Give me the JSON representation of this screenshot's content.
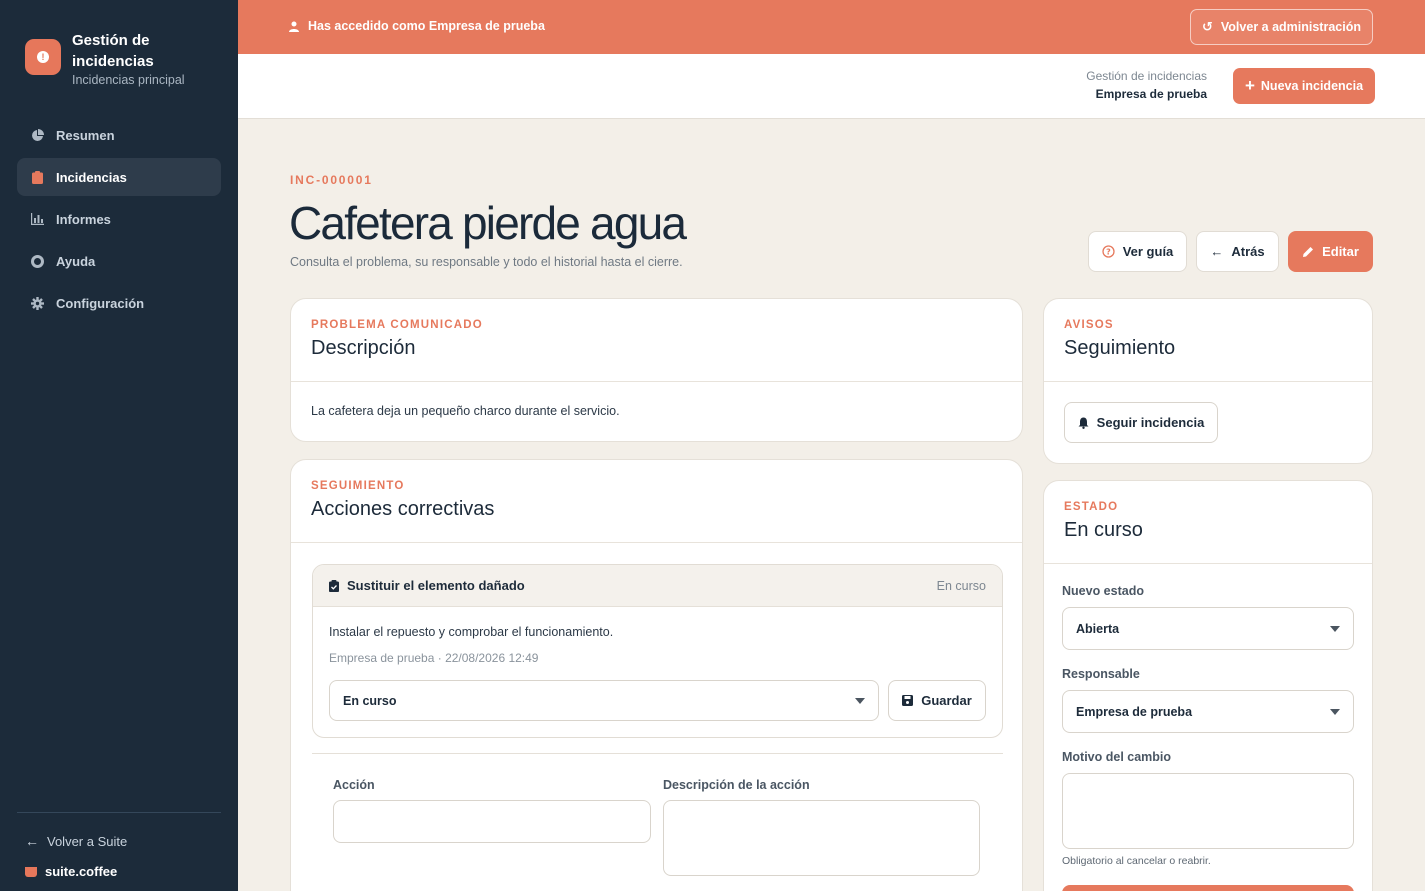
{
  "sidebar": {
    "brand_title": "Gestión de incidencias",
    "brand_sub": "Incidencias principal",
    "items": [
      {
        "label": "Resumen",
        "icon": "pie-chart-icon"
      },
      {
        "label": "Incidencias",
        "icon": "clipboard-icon",
        "active": true
      },
      {
        "label": "Informes",
        "icon": "bar-chart-icon"
      },
      {
        "label": "Ayuda",
        "icon": "lifebuoy-icon"
      },
      {
        "label": "Configuración",
        "icon": "gear-icon"
      }
    ],
    "back_label": "Volver a Suite",
    "suite_label": "suite.coffee"
  },
  "banner": {
    "text": "Has accedido como Empresa de prueba",
    "admin_button": "Volver a administración"
  },
  "header": {
    "crumb_1": "Gestión de incidencias",
    "crumb_2": "Empresa de prueba",
    "new_button": "Nueva incidencia"
  },
  "page": {
    "code": "INC-000001",
    "title": "Cafetera pierde agua",
    "subtitle": "Consulta el problema, su responsable y todo el historial hasta el cierre.",
    "guide_button": "Ver guía",
    "back_button": "Atrás",
    "edit_button": "Editar"
  },
  "description_card": {
    "eyebrow": "PROBLEMA COMUNICADO",
    "title": "Descripción",
    "body": "La cafetera deja un pequeño charco durante el servicio."
  },
  "actions_card": {
    "eyebrow": "SEGUIMIENTO",
    "title": "Acciones correctivas",
    "item": {
      "title": "Sustituir el elemento dañado",
      "status": "En curso",
      "description": "Instalar el repuesto y comprobar el funcionamiento.",
      "meta": "Empresa de prueba · 22/08/2026 12:49",
      "select_value": "En curso",
      "save_button": "Guardar"
    },
    "form": {
      "action_label": "Acción",
      "description_label": "Descripción de la acción"
    }
  },
  "follow_card": {
    "eyebrow": "AVISOS",
    "title": "Seguimiento",
    "button": "Seguir incidencia"
  },
  "state_card": {
    "eyebrow": "ESTADO",
    "title": "En curso",
    "new_state_label": "Nuevo estado",
    "new_state_value": "Abierta",
    "owner_label": "Responsable",
    "owner_value": "Empresa de prueba",
    "reason_label": "Motivo del cambio",
    "hint": "Obligatorio al cancelar o reabrir."
  },
  "colors": {
    "accent": "#e6795d",
    "sidebar": "#1c2b3a",
    "background": "#f3efe8"
  }
}
